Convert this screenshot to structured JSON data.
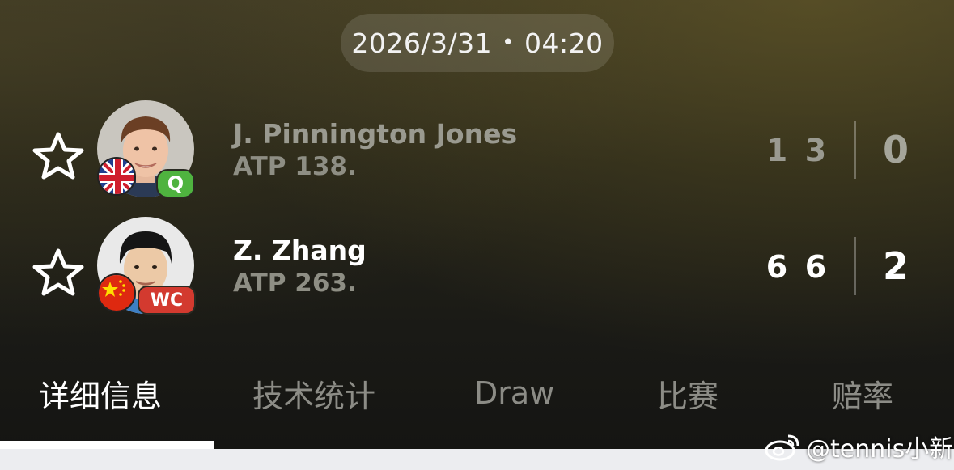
{
  "match": {
    "date": "2026/3/31",
    "separator": "•",
    "time": "04:20"
  },
  "players": [
    {
      "name": "J. Pinnington Jones",
      "rank": "ATP 138.",
      "badge": "Q",
      "flag": "united-kingdom-flag",
      "sets": [
        "1",
        "3"
      ],
      "total": "0"
    },
    {
      "name": "Z. Zhang",
      "rank": "ATP 263.",
      "badge": "WC",
      "flag": "china-flag",
      "sets": [
        "6",
        "6"
      ],
      "total": "2"
    }
  ],
  "tabs": [
    "详细信息",
    "技术统计",
    "Draw",
    "比赛",
    "赔率"
  ],
  "active_tab": "详细信息",
  "watermark": "@tennis小新",
  "colors": {
    "badge_q": "#4fb33f",
    "badge_wc": "#d33a2f",
    "active_text": "#ffffff",
    "inactive_text": "#8c8c86"
  }
}
